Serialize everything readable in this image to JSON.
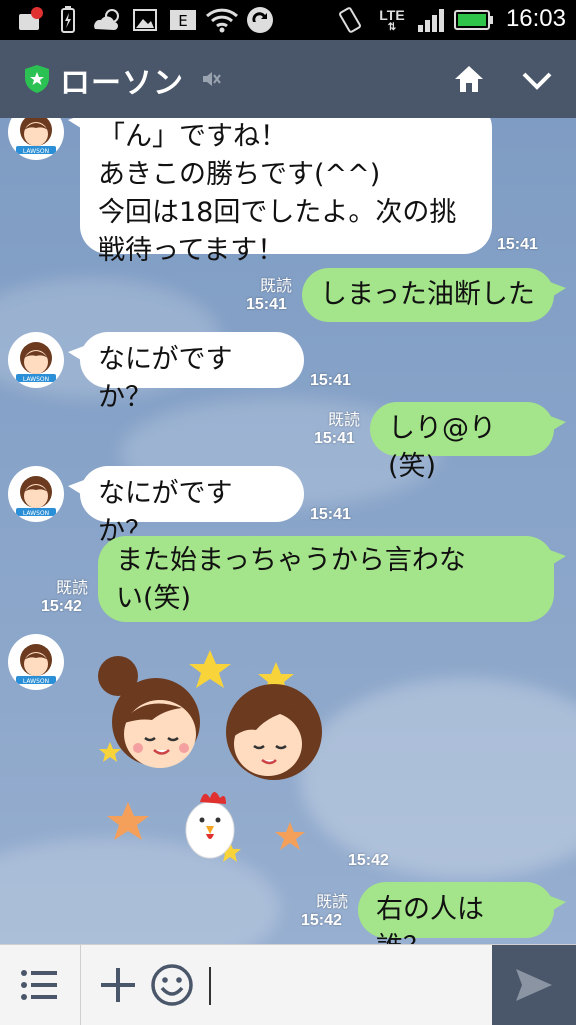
{
  "status": {
    "network": "LTE",
    "time": "16:03"
  },
  "header": {
    "title": "ローソン"
  },
  "messages": [
    {
      "side": "left",
      "lines": [
        "「ん」ですね！",
        " あきこの勝ちです(^^)",
        "今回は18回でしたよ。次の挑",
        "戦待ってます！"
      ],
      "time": "15:41"
    },
    {
      "side": "right",
      "text": "しまった油断した",
      "read": "既読",
      "time": "15:41"
    },
    {
      "side": "left",
      "text": "なにがですか？",
      "time": "15:41"
    },
    {
      "side": "right",
      "text": "しり@り(笑)",
      "read": "既読",
      "time": "15:41"
    },
    {
      "side": "left",
      "text": "なにがですか？",
      "time": "15:41"
    },
    {
      "side": "right",
      "lines": [
        "また始まっちゃうから言わな",
        "い(笑)"
      ],
      "read": "既読",
      "time": "15:42"
    },
    {
      "side": "left",
      "type": "sticker",
      "time": "15:42"
    },
    {
      "side": "right",
      "text": "右の人は誰？",
      "read": "既読",
      "time": "15:42"
    }
  ],
  "avatar": {
    "badge": "LAWSON"
  },
  "colors": {
    "header": "#4a5669",
    "sent_bubble": "#a4e48a",
    "received_bubble": "#ffffff",
    "chat_bg": "#87a3c8"
  },
  "icons": [
    "notification-icon",
    "battery-charging-icon",
    "weather-icon",
    "gallery-icon",
    "app-icon",
    "wifi-icon",
    "sync-icon",
    "rotation-icon",
    "signal-icon",
    "battery-icon",
    "shield-star-icon",
    "mute-icon",
    "home-icon",
    "chevron-down-icon",
    "menu-icon",
    "plus-icon",
    "emoji-icon",
    "send-icon"
  ]
}
